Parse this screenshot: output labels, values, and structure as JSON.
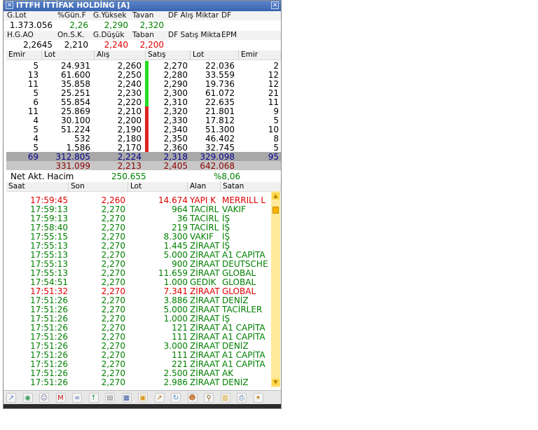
{
  "window": {
    "title": "ITTFH İTTİFAK HOLDİNG [A]"
  },
  "info1": {
    "labels": [
      "G.Lot",
      "%Gün.F",
      "G.Yüksek",
      "Tavan",
      "DF Alış Miktar",
      "DF"
    ],
    "values": [
      "1.373.056",
      "2,26",
      "2,290",
      "2,320",
      "",
      ""
    ]
  },
  "info2": {
    "labels": [
      "H.G.AO",
      "On.S.K.",
      "G.Düşük",
      "Taban",
      "DF Satış Mikta",
      "EPM"
    ],
    "values": [
      "2,2645",
      "2,210",
      "2,240",
      "2,200",
      "",
      ""
    ]
  },
  "depth_headers": [
    "Emir",
    "Lot",
    "Alış",
    "Satış",
    "Lot",
    "Emir"
  ],
  "depth_rows": [
    [
      "5",
      "24.931",
      "2,260",
      "2,270",
      "22.036",
      "2"
    ],
    [
      "13",
      "61.600",
      "2,250",
      "2,280",
      "33.559",
      "12"
    ],
    [
      "11",
      "35.858",
      "2,240",
      "2,290",
      "19.736",
      "12"
    ],
    [
      "5",
      "25.251",
      "2,230",
      "2,300",
      "61.072",
      "21"
    ],
    [
      "6",
      "55.854",
      "2,220",
      "2,310",
      "22.635",
      "11"
    ],
    [
      "11",
      "25.869",
      "2,210",
      "2,320",
      "21.801",
      "9"
    ],
    [
      "4",
      "30.100",
      "2,200",
      "2,330",
      "17.812",
      "5"
    ],
    [
      "5",
      "51.224",
      "2,190",
      "2,340",
      "51.300",
      "10"
    ],
    [
      "4",
      "532",
      "2,180",
      "2,350",
      "46.402",
      "8"
    ],
    [
      "5",
      "1.586",
      "2,170",
      "2,360",
      "32.745",
      "5"
    ]
  ],
  "depth_sum1": [
    "69",
    "312.805",
    "2,224",
    "2,318",
    "329.098",
    "95"
  ],
  "depth_sum2": [
    "",
    "331.099",
    "2,213",
    "2,405",
    "642.068",
    ""
  ],
  "net": {
    "label": "Net Akt. Hacim",
    "value": "250.655",
    "pct": "%8,06"
  },
  "trade_headers": [
    "Saat",
    "Son",
    "Lot",
    "Alan",
    "Satan"
  ],
  "trades": [
    {
      "time": "17:59:45",
      "price": "2,260",
      "lot": "14.674",
      "buyer": "YAPI K",
      "seller": "MERRILL L",
      "color": "red"
    },
    {
      "time": "17:59:13",
      "price": "2,270",
      "lot": "964",
      "buyer": "TACİRL",
      "seller": "VAKIF",
      "color": "green"
    },
    {
      "time": "17:59:13",
      "price": "2,270",
      "lot": "36",
      "buyer": "TACİRL",
      "seller": "İŞ",
      "color": "green"
    },
    {
      "time": "17:58:40",
      "price": "2,270",
      "lot": "219",
      "buyer": "TACİRL",
      "seller": "İŞ",
      "color": "green"
    },
    {
      "time": "17:55:15",
      "price": "2,270",
      "lot": "8.300",
      "buyer": "VAKIF",
      "seller": "İŞ",
      "color": "green"
    },
    {
      "time": "17:55:13",
      "price": "2,270",
      "lot": "1.445",
      "buyer": "ZİRAAT",
      "seller": "İŞ",
      "color": "green"
    },
    {
      "time": "17:55:13",
      "price": "2,270",
      "lot": "5.000",
      "buyer": "ZİRAAT",
      "seller": "A1 CAPİTA",
      "color": "green"
    },
    {
      "time": "17:55:13",
      "price": "2,270",
      "lot": "900",
      "buyer": "ZİRAAT",
      "seller": "DEUTSCHE",
      "color": "green"
    },
    {
      "time": "17:55:13",
      "price": "2,270",
      "lot": "11.659",
      "buyer": "ZİRAAT",
      "seller": "GLOBAL",
      "color": "green"
    },
    {
      "time": "17:54:51",
      "price": "2,270",
      "lot": "1.000",
      "buyer": "GEDİK",
      "seller": "GLOBAL",
      "color": "green"
    },
    {
      "time": "17:51:32",
      "price": "2,270",
      "lot": "7.341",
      "buyer": "ZİRAAT",
      "seller": "GLOBAL",
      "color": "red"
    },
    {
      "time": "17:51:26",
      "price": "2,270",
      "lot": "3.886",
      "buyer": "ZİRAAT",
      "seller": "DENİZ",
      "color": "green"
    },
    {
      "time": "17:51:26",
      "price": "2,270",
      "lot": "5.000",
      "buyer": "ZİRAAT",
      "seller": "TACİRLER",
      "color": "green"
    },
    {
      "time": "17:51:26",
      "price": "2,270",
      "lot": "1.000",
      "buyer": "ZİRAAT",
      "seller": "İŞ",
      "color": "green"
    },
    {
      "time": "17:51:26",
      "price": "2,270",
      "lot": "121",
      "buyer": "ZİRAAT",
      "seller": "A1 CAPİTA",
      "color": "green"
    },
    {
      "time": "17:51:26",
      "price": "2,270",
      "lot": "111",
      "buyer": "ZİRAAT",
      "seller": "A1 CAPİTA",
      "color": "green"
    },
    {
      "time": "17:51:26",
      "price": "2,270",
      "lot": "3.000",
      "buyer": "ZİRAAT",
      "seller": "DENİZ",
      "color": "green"
    },
    {
      "time": "17:51:26",
      "price": "2,270",
      "lot": "111",
      "buyer": "ZİRAAT",
      "seller": "A1 CAPİTA",
      "color": "green"
    },
    {
      "time": "17:51:26",
      "price": "2,270",
      "lot": "221",
      "buyer": "ZİRAAT",
      "seller": "A1 CAPİTA",
      "color": "green"
    },
    {
      "time": "17:51:26",
      "price": "2,270",
      "lot": "2.500",
      "buyer": "ZİRAAT",
      "seller": "AK",
      "color": "green"
    },
    {
      "time": "17:51:26",
      "price": "2,270",
      "lot": "2.986",
      "buyer": "ZİRAAT",
      "seller": "DENİZ",
      "color": "green"
    }
  ],
  "toolbar_icons": [
    "chart-icon",
    "globe-icon",
    "people-icon",
    "m-logo-icon",
    "link-icon",
    "arrow-up-icon",
    "document-icon",
    "grid-icon",
    "calculator-icon",
    "line-chart-icon",
    "refresh-icon",
    "group-icon",
    "magnifier-icon",
    "bars-icon",
    "print-icon",
    "star-tool-icon"
  ],
  "colors": {
    "title_bg": "#3a64b0",
    "buy_bar": "#22dd22",
    "sell_bar": "#dd2222",
    "up": "#008000",
    "down": "#dd0000",
    "sum_blue": "#00008b",
    "sum_red": "#8b0000"
  }
}
